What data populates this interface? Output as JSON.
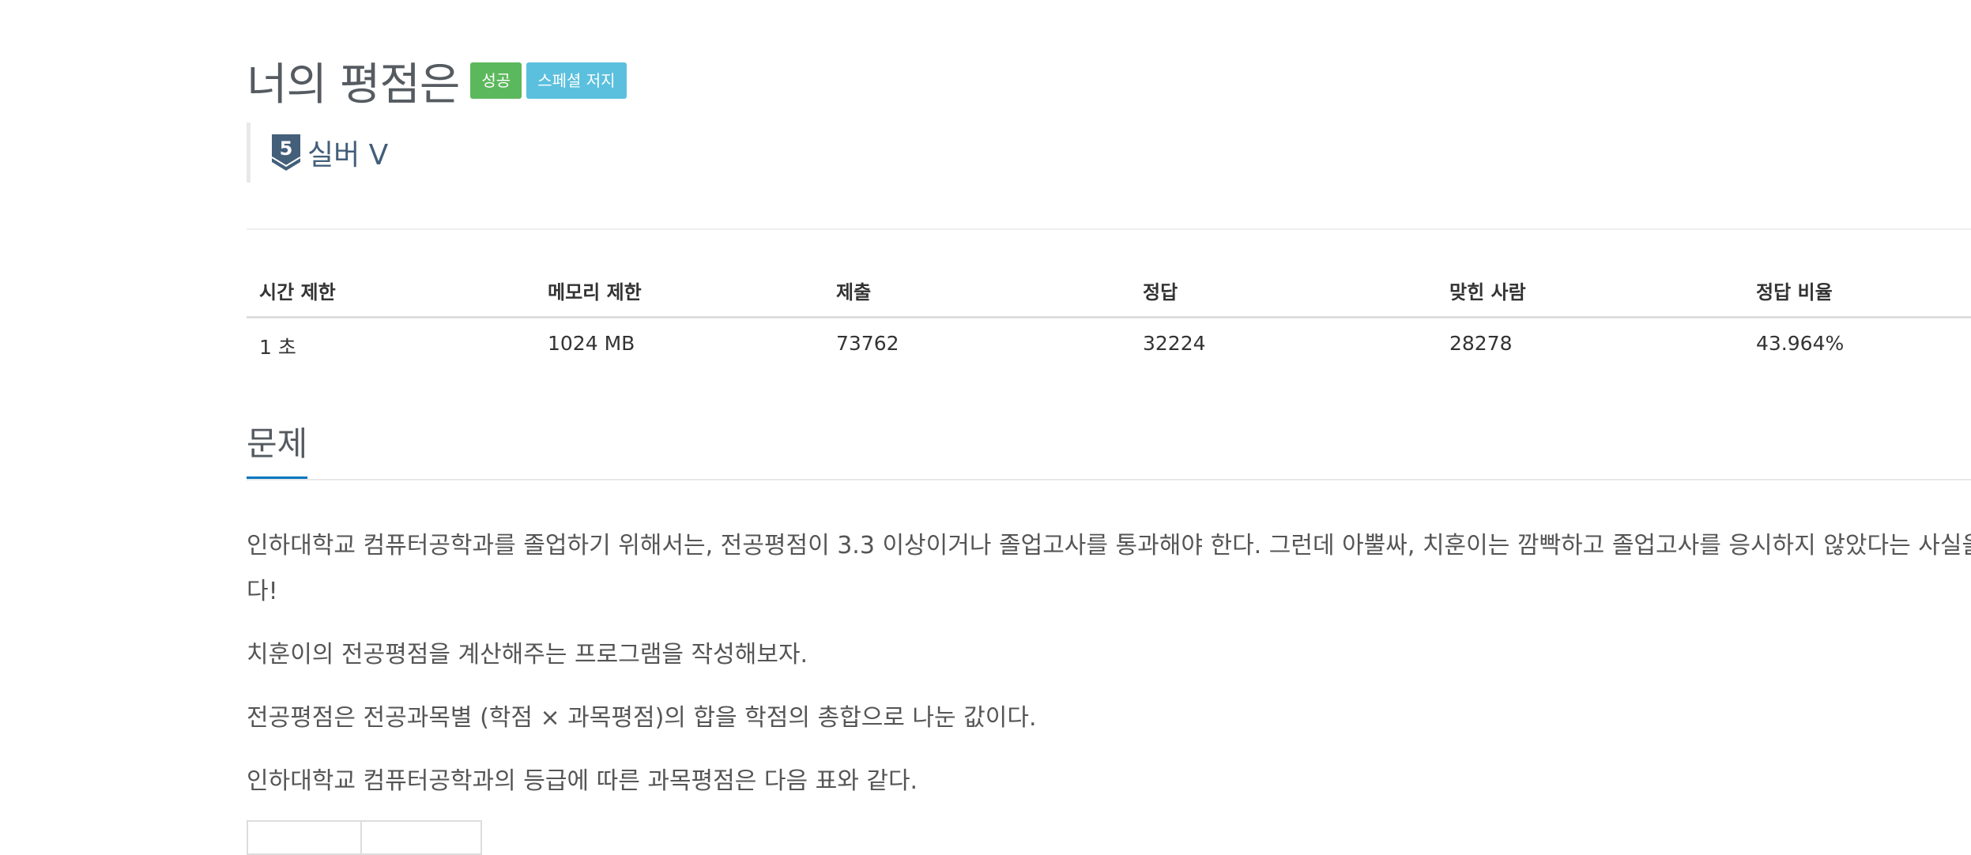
{
  "problem": {
    "title": "너의 평점은",
    "status_label": "성공",
    "judge_label": "스페셜 저지",
    "tier": {
      "number": "5",
      "name": "실버 V",
      "color": "#435f7a"
    }
  },
  "info_table": {
    "headers": [
      "시간 제한",
      "메모리 제한",
      "제출",
      "정답",
      "맞힌 사람",
      "정답 비율"
    ],
    "values": [
      "1 초",
      "1024 MB",
      "73762",
      "32224",
      "28278",
      "43.964%"
    ]
  },
  "section": {
    "title": "문제"
  },
  "description": {
    "p1_line1": "인하대학교 컴퓨터공학과를 졸업하기 위해서는, 전공평점이 3.3 이상이거나 졸업고사를 통과해야 한다. 그런데 아뿔싸, 치훈이는 깜빡하고 졸업고사를 응시하지 않았다는 사실을",
    "p1_line2": "다!",
    "p2": "치훈이의 전공평점을 계산해주는 프로그램을 작성해보자.",
    "p3": "전공평점은 전공과목별 (학점 × 과목평점)의 합을 학점의 총합으로 나눈 값이다.",
    "p4": "인하대학교 컴퓨터공학과의 등급에 따른 과목평점은 다음 표와 같다."
  },
  "colors": {
    "success": "#5cb85c",
    "info": "#5bc0de",
    "section_underline": "#0076c0",
    "title_text": "#555b61"
  }
}
